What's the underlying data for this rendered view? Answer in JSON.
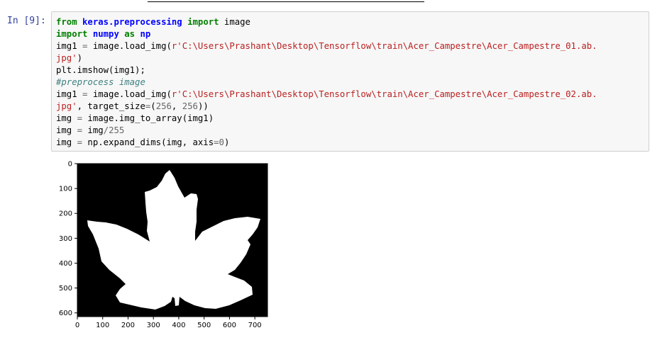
{
  "cell": {
    "prompt": "In [9]:",
    "code_lines": [
      [
        {
          "t": "from",
          "c": "kw"
        },
        {
          "t": " "
        },
        {
          "t": "keras.preprocessing",
          "c": "mod"
        },
        {
          "t": " "
        },
        {
          "t": "import",
          "c": "kw"
        },
        {
          "t": " image"
        }
      ],
      [
        {
          "t": "import",
          "c": "kw"
        },
        {
          "t": " "
        },
        {
          "t": "numpy",
          "c": "mod"
        },
        {
          "t": " "
        },
        {
          "t": "as",
          "c": "kw"
        },
        {
          "t": " "
        },
        {
          "t": "np",
          "c": "mod"
        }
      ],
      [
        {
          "t": "img1 "
        },
        {
          "t": "=",
          "c": "op"
        },
        {
          "t": " image.load_img("
        },
        {
          "t": "r'C:\\Users\\Prashant\\Desktop\\Tensorflow\\train\\Acer_Campestre\\Acer_Campestre_01.ab.",
          "c": "str"
        }
      ],
      [
        {
          "t": "jpg'",
          "c": "str"
        },
        {
          "t": ")"
        }
      ],
      [
        {
          "t": "plt.imshow(img1);"
        }
      ],
      [
        {
          "t": "#preprocess image",
          "c": "cm"
        }
      ],
      [
        {
          "t": "img1 "
        },
        {
          "t": "=",
          "c": "op"
        },
        {
          "t": " image.load_img("
        },
        {
          "t": "r'C:\\Users\\Prashant\\Desktop\\Tensorflow\\train\\Acer_Campestre\\Acer_Campestre_02.ab.",
          "c": "str"
        }
      ],
      [
        {
          "t": "jpg'",
          "c": "str"
        },
        {
          "t": ", target_size"
        },
        {
          "t": "=",
          "c": "op"
        },
        {
          "t": "("
        },
        {
          "t": "256",
          "c": "num"
        },
        {
          "t": ", "
        },
        {
          "t": "256",
          "c": "num"
        },
        {
          "t": "))"
        }
      ],
      [
        {
          "t": "img "
        },
        {
          "t": "=",
          "c": "op"
        },
        {
          "t": " image.img_to_array(img1)"
        }
      ],
      [
        {
          "t": "img "
        },
        {
          "t": "=",
          "c": "op"
        },
        {
          "t": " img"
        },
        {
          "t": "/",
          "c": "op"
        },
        {
          "t": "255",
          "c": "num"
        }
      ],
      [
        {
          "t": "img "
        },
        {
          "t": "=",
          "c": "op"
        },
        {
          "t": " np.expand_dims(img, axis"
        },
        {
          "t": "=",
          "c": "op"
        },
        {
          "t": "0",
          "c": "num"
        },
        {
          "t": ")"
        }
      ]
    ]
  },
  "plot": {
    "y_ticks": [
      "0",
      "100",
      "200",
      "300",
      "400",
      "500",
      "600"
    ],
    "x_ticks": [
      "0",
      "100",
      "200",
      "300",
      "400",
      "500",
      "600",
      "700"
    ],
    "colors": {
      "background": "#000000",
      "leaf": "#ffffff"
    }
  }
}
